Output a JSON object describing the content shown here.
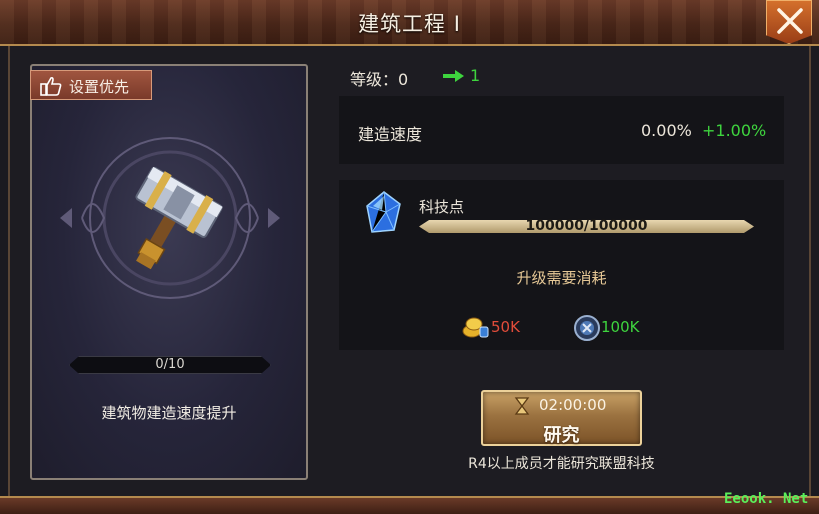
{
  "window": {
    "title": "建筑工程 I"
  },
  "card": {
    "priority_label": "设置优先",
    "progress_text": "0/10",
    "progress": 0,
    "description": "建筑物建造速度提升"
  },
  "level": {
    "label": "等级：0",
    "next": "1"
  },
  "speed": {
    "label": "建造速度",
    "current": "0.00%",
    "bonus": "+1.00%"
  },
  "tech": {
    "label": "科技点",
    "progress_text": "100000/100000",
    "progress": 1.0
  },
  "cost": {
    "title": "升级需要消耗",
    "gold": "50K",
    "alliance": "100K"
  },
  "research": {
    "timer": "02:00:00",
    "label": "研究"
  },
  "note": "R4以上成员才能研究联盟科技",
  "watermark": "Eeook. Net",
  "colors": {
    "accent_green": "#3ed43e",
    "cost_red": "#e04c3a",
    "button_gold": "#c9a166"
  },
  "icons": [
    "close-icon",
    "thumbs-up-icon",
    "hammer-emblem-icon",
    "arrow-right-icon",
    "crystal-icon",
    "gold-coins-icon",
    "alliance-shield-icon",
    "hourglass-icon"
  ]
}
